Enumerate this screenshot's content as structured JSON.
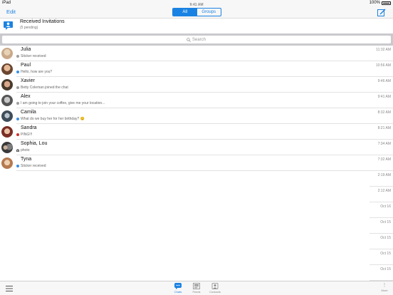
{
  "statusbar": {
    "device": "iPad",
    "time": "9:41 AM",
    "battery": "100%"
  },
  "navbar": {
    "edit_label": "Edit",
    "segments": [
      "All",
      "Groups"
    ],
    "active_segment": "All"
  },
  "invitations": {
    "title": "Received Invitations",
    "subtitle": "(5 pending)"
  },
  "search": {
    "placeholder": "Search"
  },
  "chats": [
    {
      "name": "Julia",
      "message": "Sticker received",
      "time": "11:32 AM",
      "dot_color": "#9e9e9e",
      "avatar_color": "#c9a989"
    },
    {
      "name": "Paul",
      "message": "Hello, how are you?",
      "time": "10:56 AM",
      "dot_color": "#3b8fe6",
      "avatar_color": "#b07a55"
    },
    {
      "name": "Xavier",
      "message": "Betty Coleman joined the chat",
      "time": "9:46 AM",
      "dot_color": "#9e9e9e",
      "avatar_color": "#8c6f57"
    },
    {
      "name": "Alex",
      "message": "I am going to join your coffee, give me your location...",
      "time": "9:41 AM",
      "dot_color": "#9e9e9e",
      "avatar_color": "#777777"
    },
    {
      "name": "Camila",
      "message": "What do we buy her for her birthday? 😊",
      "time": "8:32 AM",
      "dot_color": "#3b8fe6",
      "avatar_color": "#5a6b7a"
    },
    {
      "name": "Sandra",
      "message": "PING!!!",
      "time": "8:21 AM",
      "dot_color": "#d0312d",
      "avatar_color": "#a34a3f"
    },
    {
      "name": "Sophia, Lou",
      "message": "photo",
      "time": "7:34 AM",
      "dot_color": "#555555",
      "avatar_color": "#6f6f6f"
    },
    {
      "name": "Tyna",
      "message": "Sticker received",
      "time": "7:32 AM",
      "dot_color": "#3b8fe6",
      "avatar_color": "#c48f66"
    }
  ],
  "older_times": [
    "2:19 AM",
    "2:12 AM",
    "Oct 16",
    "Oct 15",
    "Oct 15",
    "Oct 15",
    "Oct 15"
  ],
  "tabbar": {
    "tabs": [
      "Chats",
      "Feeds",
      "Contacts"
    ],
    "active": "Chats",
    "more_label": "More"
  },
  "colors": {
    "accent": "#1a82e2"
  }
}
